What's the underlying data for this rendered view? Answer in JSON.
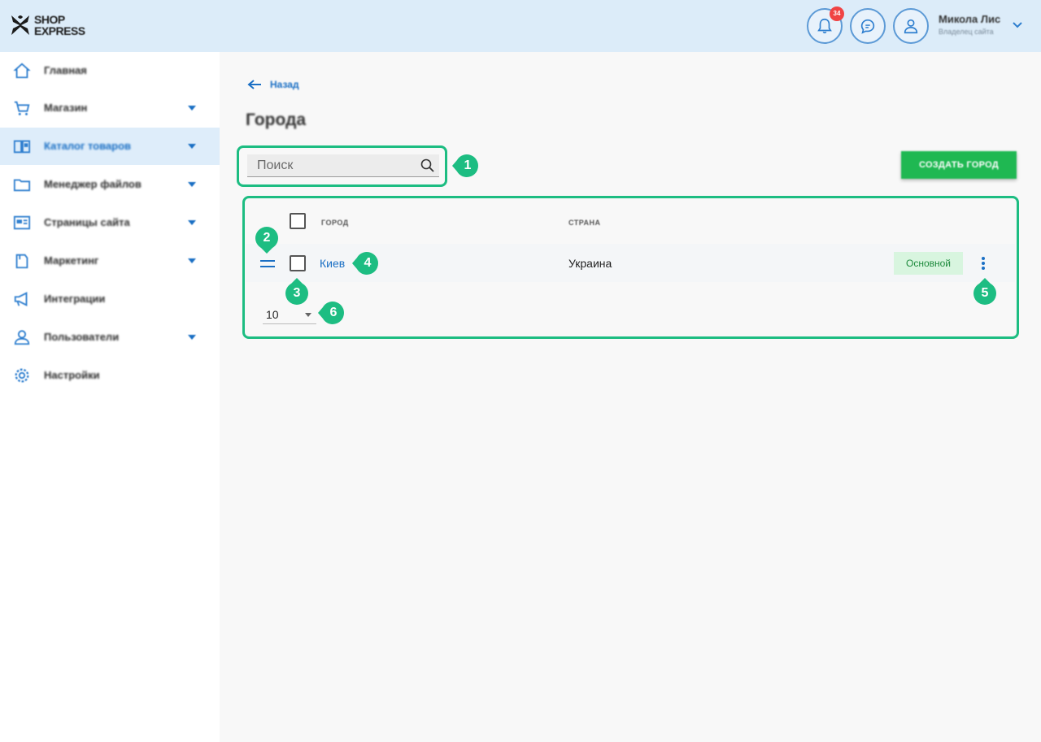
{
  "brand": {
    "line1": "SHOP",
    "line2": "EXPRESS"
  },
  "header": {
    "notifications_count": "34",
    "user_name": "Микола Лис",
    "user_role": "Владелец сайта"
  },
  "sidebar": {
    "items": [
      {
        "label": "Главная",
        "icon": "home-icon",
        "has_caret": false,
        "active": false
      },
      {
        "label": "Магазин",
        "icon": "cart-icon",
        "has_caret": true,
        "active": false
      },
      {
        "label": "Каталог товаров",
        "icon": "book-icon",
        "has_caret": true,
        "active": true
      },
      {
        "label": "Менеджер файлов",
        "icon": "folder-icon",
        "has_caret": true,
        "active": false
      },
      {
        "label": "Страницы сайта",
        "icon": "pages-icon",
        "has_caret": true,
        "active": false
      },
      {
        "label": "Маркетинг",
        "icon": "marketing-icon",
        "has_caret": true,
        "active": false
      },
      {
        "label": "Интеграции",
        "icon": "megaphone-icon",
        "has_caret": false,
        "active": false
      },
      {
        "label": "Пользователи",
        "icon": "users-icon",
        "has_caret": true,
        "active": false
      },
      {
        "label": "Настройки",
        "icon": "gear-icon",
        "has_caret": false,
        "active": false
      }
    ]
  },
  "main": {
    "back_label": "Назад",
    "title": "Города",
    "search_placeholder": "Поиск",
    "create_button": "СОЗДАТЬ ГОРОД",
    "table": {
      "columns": [
        "ГОРОД",
        "СТРАНА"
      ],
      "rows": [
        {
          "city": "Киев",
          "country": "Украина",
          "badge": "Основной"
        }
      ]
    },
    "per_page": "10"
  },
  "markers": [
    "1",
    "2",
    "3",
    "4",
    "5",
    "6"
  ],
  "colors": {
    "accent": "#1a6fc4",
    "marker": "#1dbd82",
    "create": "#1fb852",
    "header_bg": "#dcecf9"
  }
}
